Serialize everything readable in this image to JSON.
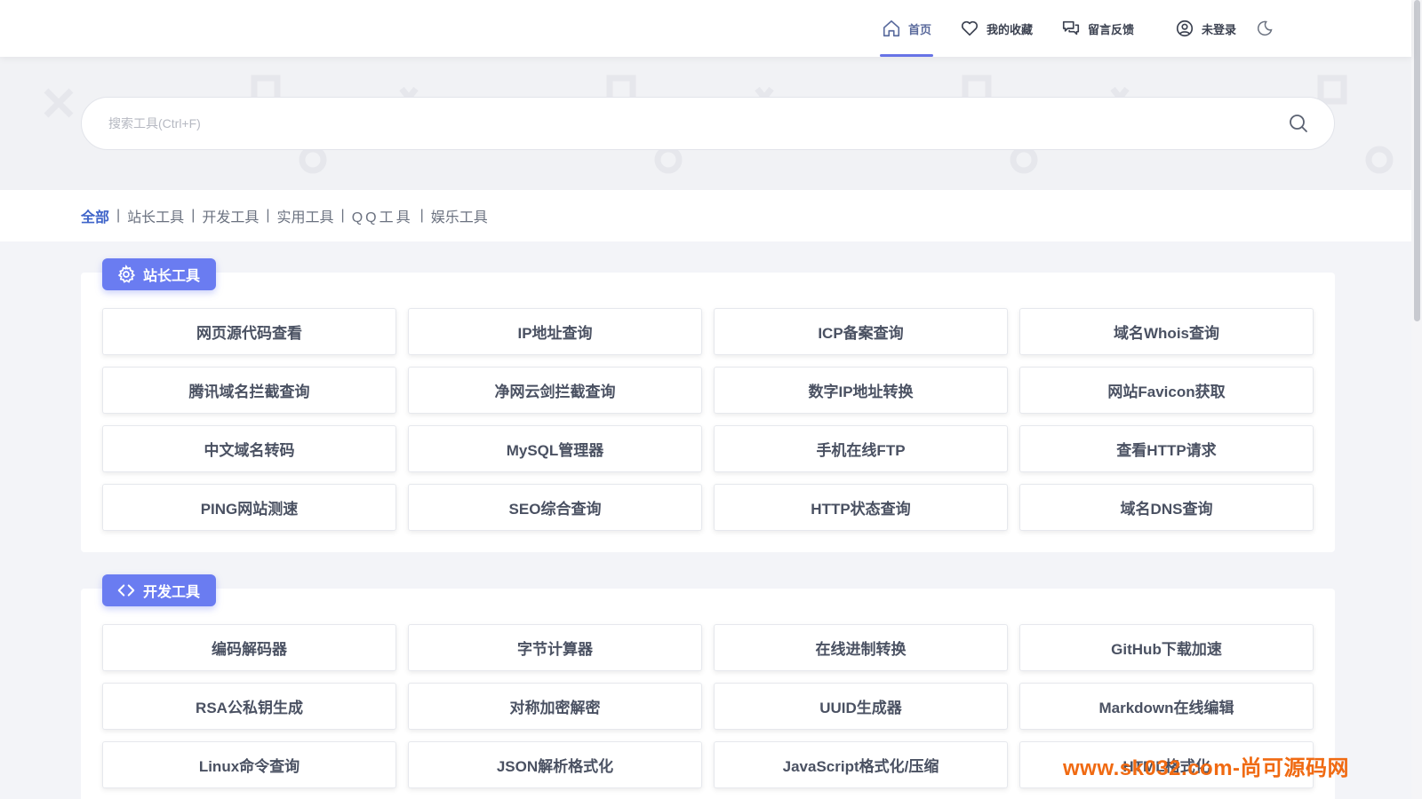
{
  "nav": {
    "home": "首页",
    "favorites": "我的收藏",
    "feedback": "留言反馈",
    "login": "未登录",
    "icons": [
      "home-icon",
      "heart-icon",
      "chat-icon",
      "user-icon",
      "moon-icon"
    ]
  },
  "search": {
    "placeholder": "搜索工具(Ctrl+F)"
  },
  "categories": {
    "all": "全部",
    "webmaster": "站长工具",
    "dev": "开发工具",
    "utility": "实用工具",
    "qq": "QQ工具",
    "fun": "娱乐工具",
    "separator": "|"
  },
  "sections": {
    "webmaster": {
      "label": "站长工具",
      "icon": "gear-icon",
      "tools": [
        "网页源代码查看",
        "IP地址查询",
        "ICP备案查询",
        "域名Whois查询",
        "腾讯域名拦截查询",
        "净网云剑拦截查询",
        "数字IP地址转换",
        "网站Favicon获取",
        "中文域名转码",
        "MySQL管理器",
        "手机在线FTP",
        "查看HTTP请求",
        "PING网站测速",
        "SEO综合查询",
        "HTTP状态查询",
        "域名DNS查询"
      ]
    },
    "dev": {
      "label": "开发工具",
      "icon": "code-icon",
      "tools": [
        "编码解码器",
        "字节计算器",
        "在线进制转换",
        "GitHub下载加速",
        "RSA公私钥生成",
        "对称加密解密",
        "UUID生成器",
        "Markdown在线编辑",
        "Linux命令查询",
        "JSON解析格式化",
        "JavaScript格式化/压缩",
        "HTML格式化"
      ]
    }
  },
  "watermark": "www.sk032.com-尚可源码网",
  "colors": {
    "accent": "#6a7cf1",
    "active_link": "#3e63c9",
    "watermark": "#f06a12"
  }
}
